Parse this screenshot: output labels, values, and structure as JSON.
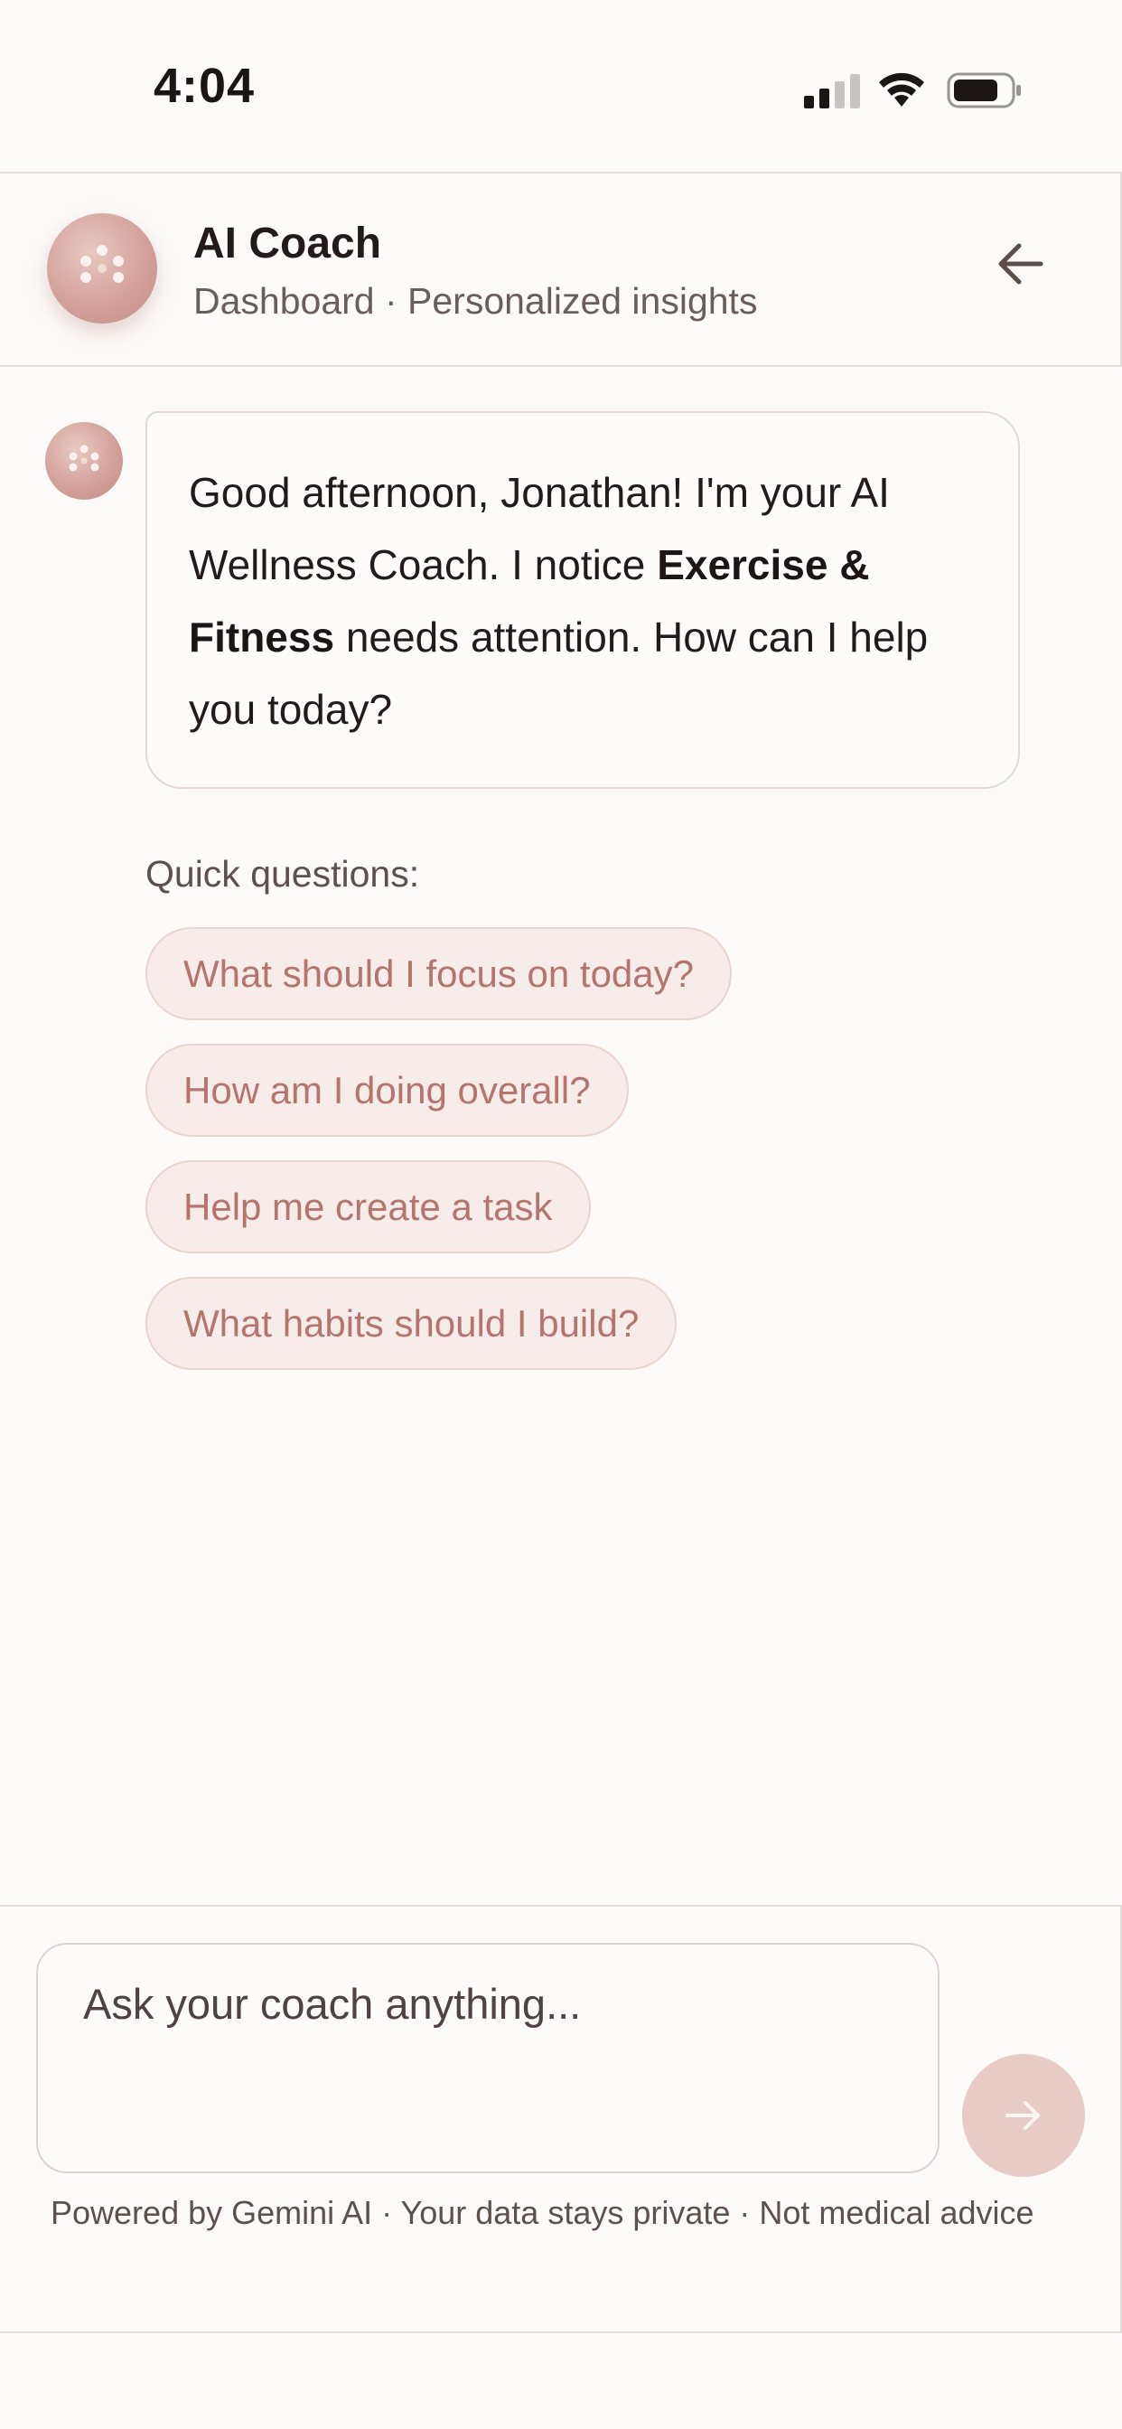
{
  "status_bar": {
    "time": "4:04",
    "icons": [
      "signal-icon",
      "wifi-icon",
      "battery-icon"
    ]
  },
  "header": {
    "title": "AI Coach",
    "subtitle": "Dashboard · Personalized insights",
    "back_icon": "arrow-left-icon"
  },
  "conversation": {
    "message": {
      "part1": "Good afternoon, Jonathan! I'm your AI Wellness Coach. I notice ",
      "highlight": "Exercise & Fitness",
      "part2": " needs attention. How can I help you today?"
    },
    "quick_questions_label": "Quick questions:",
    "quick_questions": [
      "What should I focus on today?",
      "How am I doing overall?",
      "Help me create a task",
      "What habits should I build?"
    ]
  },
  "composer": {
    "placeholder": "Ask your coach anything...",
    "send_icon": "arrow-right-icon",
    "disclaimer": "Powered by Gemini AI · Your data stays private · Not medical advice"
  },
  "colors": {
    "accent": "#d3a29a",
    "chip_text": "#b3756c",
    "chip_bg": "#f7ecea",
    "background": "#fdfbf9"
  }
}
